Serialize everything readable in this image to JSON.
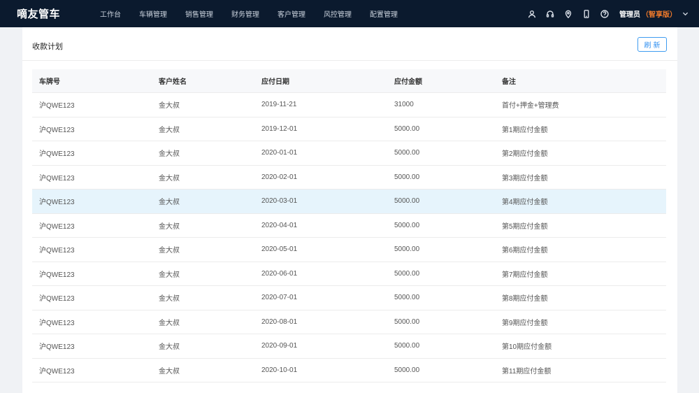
{
  "app": {
    "brand": "嘀友管车"
  },
  "nav": {
    "items": [
      {
        "label": "工作台"
      },
      {
        "label": "车辆管理"
      },
      {
        "label": "销售管理"
      },
      {
        "label": "财务管理"
      },
      {
        "label": "客户管理"
      },
      {
        "label": "风控管理"
      },
      {
        "label": "配置管理"
      }
    ]
  },
  "toolbar": {
    "icons": [
      "user-icon",
      "headset-icon",
      "location-icon",
      "mobile-icon",
      "help-icon"
    ],
    "user": {
      "name": "管理员",
      "edition": "（智享版）"
    }
  },
  "panel": {
    "title": "收款计划",
    "refresh_label": "刷新"
  },
  "table": {
    "headers": [
      "车牌号",
      "客户姓名",
      "应付日期",
      "应付金额",
      "备注"
    ],
    "rows": [
      {
        "plate": "沪QWE123",
        "customer": "金大叔",
        "date": "2019-11-21",
        "amount": "31000",
        "note": "首付+押金+管理费"
      },
      {
        "plate": "沪QWE123",
        "customer": "金大叔",
        "date": "2019-12-01",
        "amount": "5000.00",
        "note": "第1期应付金额"
      },
      {
        "plate": "沪QWE123",
        "customer": "金大叔",
        "date": "2020-01-01",
        "amount": "5000.00",
        "note": "第2期应付金额"
      },
      {
        "plate": "沪QWE123",
        "customer": "金大叔",
        "date": "2020-02-01",
        "amount": "5000.00",
        "note": "第3期应付金额"
      },
      {
        "plate": "沪QWE123",
        "customer": "金大叔",
        "date": "2020-03-01",
        "amount": "5000.00",
        "note": "第4期应付金额"
      },
      {
        "plate": "沪QWE123",
        "customer": "金大叔",
        "date": "2020-04-01",
        "amount": "5000.00",
        "note": "第5期应付金额"
      },
      {
        "plate": "沪QWE123",
        "customer": "金大叔",
        "date": "2020-05-01",
        "amount": "5000.00",
        "note": "第6期应付金额"
      },
      {
        "plate": "沪QWE123",
        "customer": "金大叔",
        "date": "2020-06-01",
        "amount": "5000.00",
        "note": "第7期应付金额"
      },
      {
        "plate": "沪QWE123",
        "customer": "金大叔",
        "date": "2020-07-01",
        "amount": "5000.00",
        "note": "第8期应付金额"
      },
      {
        "plate": "沪QWE123",
        "customer": "金大叔",
        "date": "2020-08-01",
        "amount": "5000.00",
        "note": "第9期应付金额"
      },
      {
        "plate": "沪QWE123",
        "customer": "金大叔",
        "date": "2020-09-01",
        "amount": "5000.00",
        "note": "第10期应付金额"
      },
      {
        "plate": "沪QWE123",
        "customer": "金大叔",
        "date": "2020-10-01",
        "amount": "5000.00",
        "note": "第11期应付金额"
      }
    ],
    "highlighted_row": 4
  },
  "colors": {
    "topbar": "#0b1a2e",
    "accent": "#2f8ff0",
    "edition": "#f07a2b",
    "row_highlight": "#e6f4fc"
  }
}
